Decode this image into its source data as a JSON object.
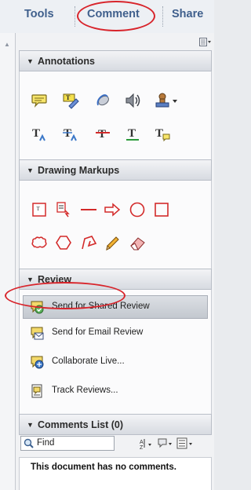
{
  "tabs": {
    "tools": "Tools",
    "comment": "Comment",
    "share": "Share"
  },
  "sections": {
    "annotations": "Annotations",
    "drawing_markups": "Drawing Markups",
    "review": "Review",
    "comments_list": "Comments List (0)"
  },
  "annotation_tools": [
    "sticky-note",
    "highlight-text",
    "attach-file",
    "record-audio",
    "add-stamp",
    "insert-text",
    "replace-text",
    "strikethrough",
    "underline",
    "text-correction"
  ],
  "drawing_tools": [
    "text-box",
    "callout",
    "line",
    "arrow",
    "oval",
    "rectangle",
    "cloud",
    "polygon",
    "connected-lines",
    "pencil",
    "eraser"
  ],
  "review": {
    "items": [
      {
        "label": "Send for Shared Review",
        "icon": "shared-review-icon"
      },
      {
        "label": "Send for Email Review",
        "icon": "email-review-icon"
      },
      {
        "label": "Collaborate Live...",
        "icon": "collaborate-icon"
      },
      {
        "label": "Track Reviews...",
        "icon": "track-reviews-icon"
      }
    ]
  },
  "comments_list": {
    "find_placeholder": "Find",
    "empty_message": "This document has no comments."
  },
  "colors": {
    "tab_text": "#3f5f8c",
    "highlight_ring": "#d8242b",
    "tool_red": "#d32a2a",
    "tool_blue": "#3c78c8"
  }
}
